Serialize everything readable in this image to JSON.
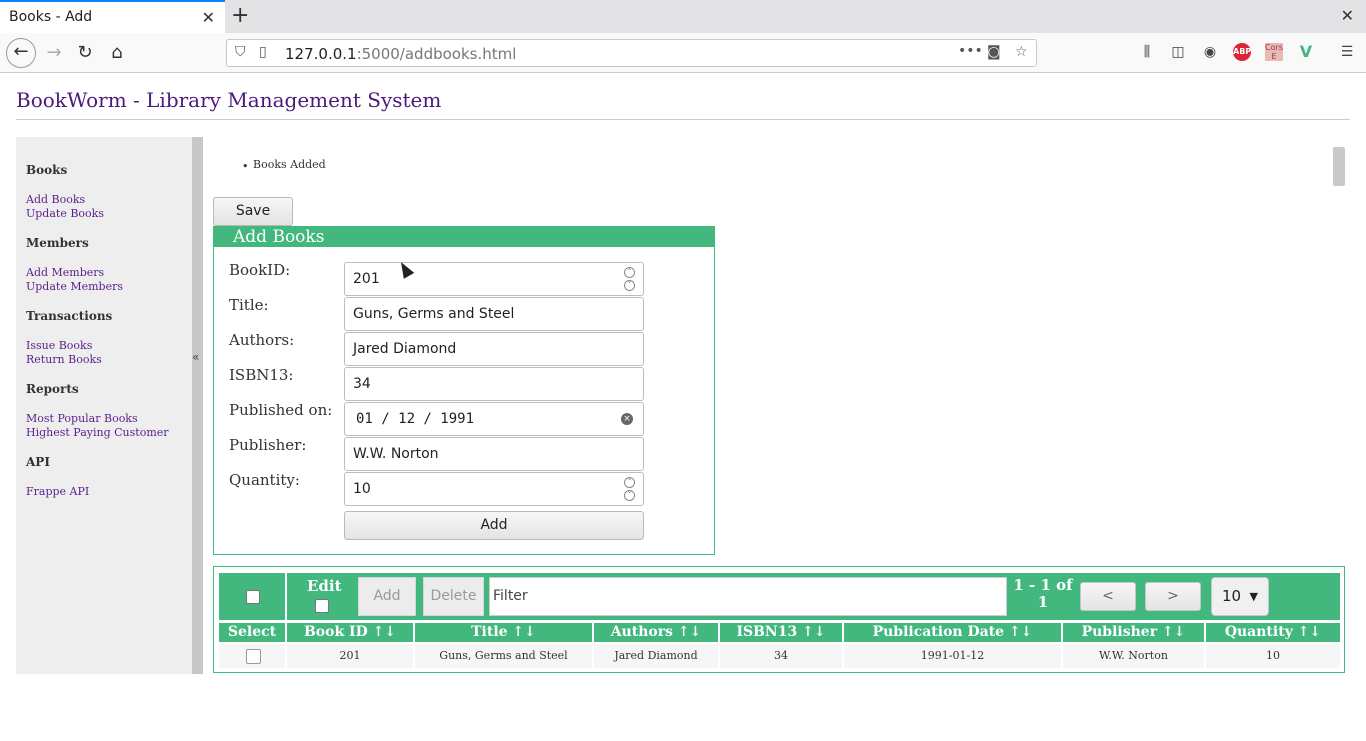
{
  "browser": {
    "tab_title": "Books - Add",
    "url_host": "127.0.0.1",
    "url_rest": ":5000/addbooks.html",
    "tab_close": "✕",
    "new_tab": "+",
    "window_close": "✕",
    "overflow": "•••",
    "abp_label": "ABP",
    "cors_label": "Cors E"
  },
  "app": {
    "title": "BookWorm - Library Management System"
  },
  "sidebar": {
    "collapse": "«",
    "sections": [
      {
        "heading": "Books",
        "links": [
          "Add Books",
          "Update Books"
        ]
      },
      {
        "heading": "Members",
        "links": [
          "Add Members",
          "Update Members"
        ]
      },
      {
        "heading": "Transactions",
        "links": [
          "Issue Books",
          "Return Books"
        ]
      },
      {
        "heading": "Reports",
        "links": [
          "Most Popular Books",
          "Highest Paying Customer"
        ]
      },
      {
        "heading": "API",
        "links": [
          "Frappe API"
        ]
      }
    ]
  },
  "notice": {
    "bullet": "•",
    "message": "Books Added"
  },
  "save_label": "Save",
  "form": {
    "heading": "Add Books",
    "fields": [
      {
        "label": "BookID:",
        "value": "201"
      },
      {
        "label": "Title:",
        "value": "Guns, Germs and Steel"
      },
      {
        "label": "Authors:",
        "value": "Jared Diamond"
      },
      {
        "label": "ISBN13:",
        "value": "34"
      },
      {
        "label": "Published on:",
        "value": "01 / 12 / 1991"
      },
      {
        "label": "Publisher:",
        "value": "W.W. Norton"
      },
      {
        "label": "Quantity:",
        "value": "10"
      }
    ],
    "add_label": "Add"
  },
  "table": {
    "edit_label": "Edit",
    "add_label": "Add",
    "delete_label": "Delete",
    "filter_placeholder": "Filter",
    "page_info_1": "1 - 1 of",
    "page_info_2": "1",
    "prev_label": "<",
    "next_label": ">",
    "page_size": "10",
    "columns": [
      "Select",
      "Book ID ↑↓",
      "Title ↑↓",
      "Authors ↑↓",
      "ISBN13 ↑↓",
      "Publication Date ↑↓",
      "Publisher ↑↓",
      "Quantity ↑↓"
    ],
    "rows": [
      {
        "book_id": "201",
        "title": "Guns, Germs and Steel",
        "authors": "Jared Diamond",
        "isbn13": "34",
        "publication_date": "1991-01-12",
        "publisher": "W.W. Norton",
        "quantity": "10"
      }
    ]
  }
}
